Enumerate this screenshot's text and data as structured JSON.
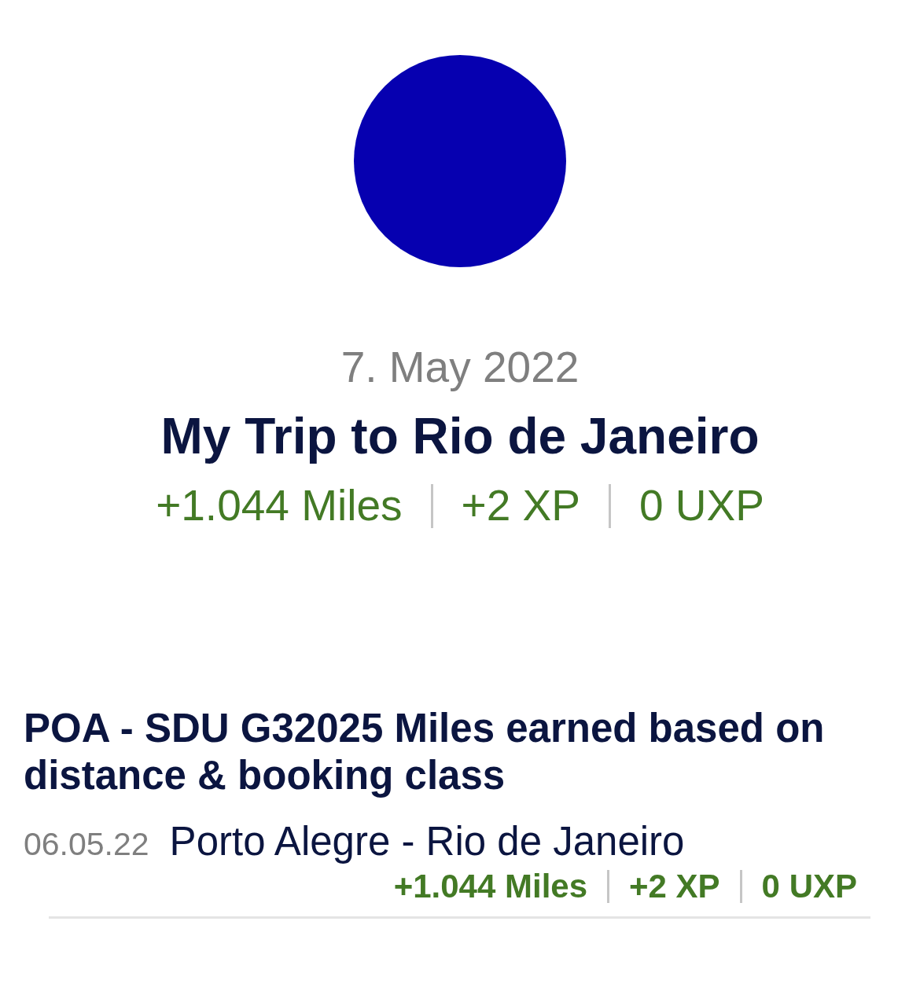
{
  "trip": {
    "date": "7. May 2022",
    "title": "My Trip to Rio de Janeiro",
    "stats": [
      "+1.044 Miles",
      "+2 XP",
      "0 UXP"
    ]
  },
  "entries": [
    {
      "heading": "POA - SDU G32025 Miles earned based on distance & booking class",
      "date": "06.05.22",
      "route": "Porto Alegre - Rio de Janeiro",
      "stats": [
        "+1.044 Miles",
        "+2 XP",
        "0 UXP"
      ]
    }
  ]
}
